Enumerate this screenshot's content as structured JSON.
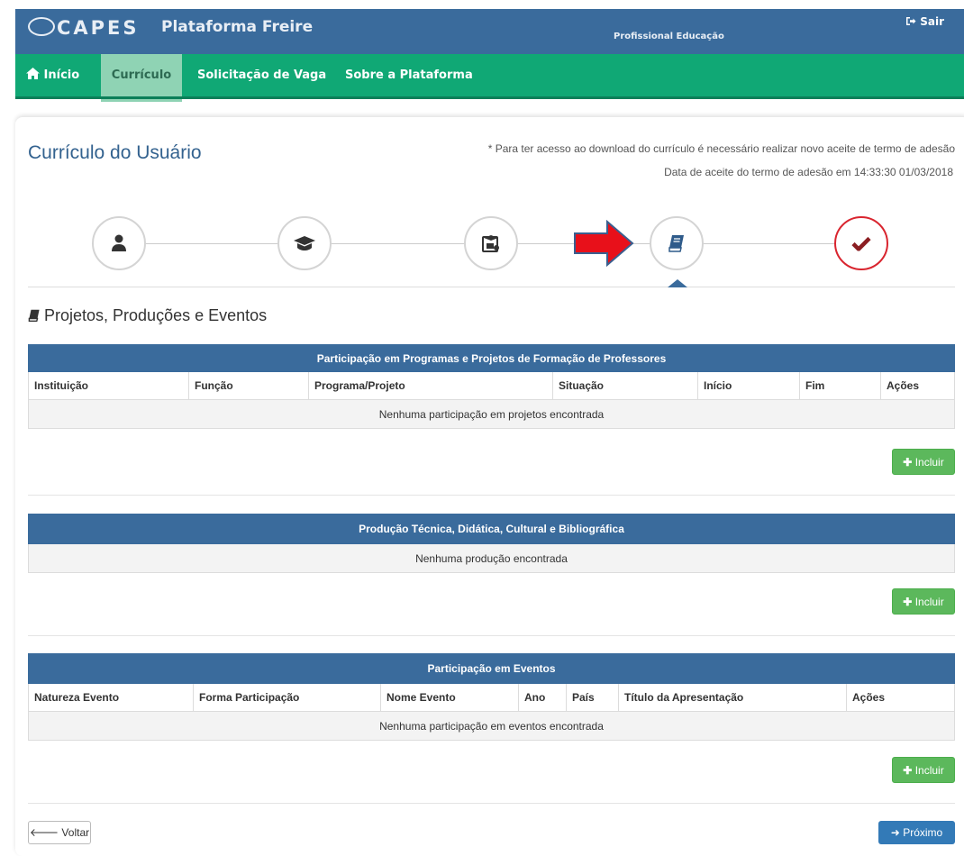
{
  "header": {
    "logo": "CAPES",
    "platform": "Plataforma Freire",
    "profile": "Profissional Educação",
    "logout": "Sair"
  },
  "nav": {
    "home": "Início",
    "curriculo": "Currículo",
    "solicitacao": "Solicitação de Vaga",
    "sobre": "Sobre a Plataforma"
  },
  "page": {
    "title": "Currículo do Usuário",
    "notice": "* Para ter acesso ao download do currículo é necessário realizar novo aceite de termo de adesão",
    "accept_date": "Data de aceite do termo de adesão em 14:33:30 01/03/2018"
  },
  "steps": [
    {
      "icon": "user-icon"
    },
    {
      "icon": "graduation-cap-icon"
    },
    {
      "icon": "certificate-icon"
    },
    {
      "icon": "book-icon",
      "active": true
    },
    {
      "icon": "check-icon",
      "done": true
    }
  ],
  "section": {
    "title": "Projetos, Produções e Eventos"
  },
  "table_projects": {
    "caption": "Participação em Programas e Projetos de Formação de Professores",
    "columns": [
      "Instituição",
      "Função",
      "Programa/Projeto",
      "Situação",
      "Início",
      "Fim",
      "Ações"
    ],
    "empty": "Nenhuma participação em projetos encontrada"
  },
  "table_productions": {
    "caption": "Produção Técnica, Didática, Cultural e Bibliográfica",
    "empty": "Nenhuma produção encontrada"
  },
  "table_events": {
    "caption": "Participação em Eventos",
    "columns": [
      "Natureza Evento",
      "Forma Participação",
      "Nome Evento",
      "Ano",
      "País",
      "Título da Apresentação",
      "Ações"
    ],
    "empty": "Nenhuma participação em eventos encontrada"
  },
  "buttons": {
    "include": "Incluir",
    "back": "Voltar",
    "next": "Próximo"
  },
  "colors": {
    "header": "#3a6b9c",
    "nav": "#10a875",
    "accent_red": "#e8101a",
    "success": "#5cb85c",
    "primary": "#337ab7"
  }
}
